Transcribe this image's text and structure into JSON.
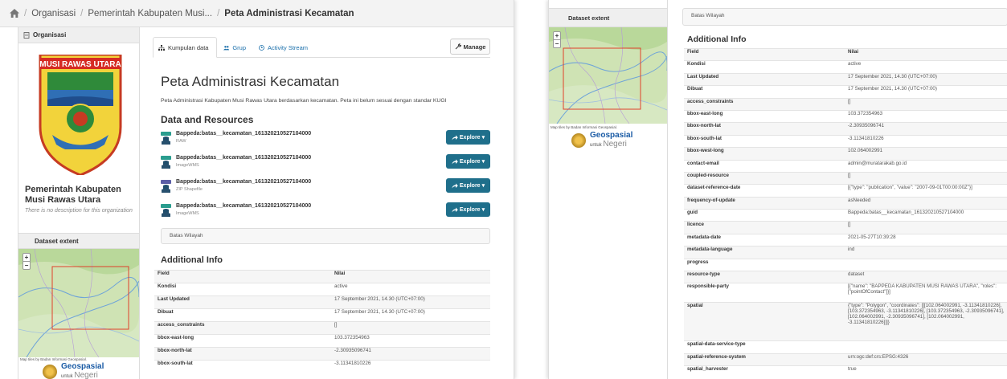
{
  "breadcrumb": {
    "items": [
      "Organisasi",
      "Pemerintah Kabupaten Musi..."
    ],
    "current": "Peta Administrasi Kecamatan"
  },
  "sidebar": {
    "org_heading": "Organisasi",
    "logo_text": "MUSI RAWAS UTARA",
    "org_name": "Pemerintah Kabupaten Musi Rawas Utara",
    "org_description": "There is no description for this organization",
    "extent_heading": "Dataset extent",
    "map_zoom_in": "+",
    "map_zoom_out": "−",
    "map_credit": "Map tiles by Badan Informasi Geospasial.",
    "geo_logo_name": "Geospasial",
    "geo_logo_for": "untuk",
    "geo_logo_country": "Negeri"
  },
  "tabs": [
    {
      "label": "Kumpulan data",
      "icon": "sitemap-icon",
      "active": true
    },
    {
      "label": "Grup",
      "icon": "users-icon",
      "active": false
    },
    {
      "label": "Activity Stream",
      "icon": "clock-icon",
      "active": false
    }
  ],
  "manage_label": "Manage",
  "dataset": {
    "title": "Peta Administrasi Kecamatan",
    "notes": "Peta Administrasi Kabupaten Musi Rawas Utara berdasarkan kecamatan. Peta ini belum sesuai dengan standar KUGI"
  },
  "resources_heading": "Data and Resources",
  "resources": [
    {
      "name": "Bappeda:batas__kecamatan_161320210527104000",
      "format": "RAW",
      "explore": "Explore"
    },
    {
      "name": "Bappeda:batas__kecamatan_161320210527104000",
      "format": "ImageWMS",
      "explore": "Explore"
    },
    {
      "name": "Bappeda:batas__kecamatan_161320210527104000",
      "format": "ZIP Shapefile",
      "explore": "Explore"
    },
    {
      "name": "Bappeda:batas__kecamatan_161320210527104000",
      "format": "ImageWMS",
      "explore": "Explore"
    }
  ],
  "tag": "Batas Wilayah",
  "additional_info_heading": "Additional Info",
  "info_headers": {
    "field": "Field",
    "value": "Nilai"
  },
  "info_rows": [
    {
      "field": "Kondisi",
      "value": "active"
    },
    {
      "field": "Last Updated",
      "value": "17 September 2021, 14.30 (UTC+07:00)"
    },
    {
      "field": "Dibuat",
      "value": "17 September 2021, 14.30 (UTC+07:00)"
    },
    {
      "field": "access_constraints",
      "value": "[]"
    },
    {
      "field": "bbox-east-long",
      "value": "103.372354963"
    },
    {
      "field": "bbox-north-lat",
      "value": "-2.30935096741"
    },
    {
      "field": "bbox-south-lat",
      "value": "-3.11341810226"
    },
    {
      "field": "bbox-west-long",
      "value": "102.064002991"
    },
    {
      "field": "contact-email",
      "value": "admin@muratarakab.go.id"
    },
    {
      "field": "coupled-resource",
      "value": "[]"
    },
    {
      "field": "dataset-reference-date",
      "value": "[{\"type\": \"publication\", \"value\": \"2007-09-01T00:00:00Z\"}]"
    },
    {
      "field": "frequency-of-update",
      "value": "asNeeded"
    },
    {
      "field": "guid",
      "value": "Bappeda:batas__kecamatan_161320210527104000"
    },
    {
      "field": "licence",
      "value": "[]"
    },
    {
      "field": "metadata-date",
      "value": "2021-05-27T10:39:28"
    },
    {
      "field": "metadata-language",
      "value": "ind"
    },
    {
      "field": "progress",
      "value": ""
    },
    {
      "field": "resource-type",
      "value": "dataset"
    },
    {
      "field": "responsible-party",
      "value": "[{\"name\": \"BAPPEDA KABUPATEN MUSI RAWAS UTARA\", \"roles\": [\"pointOfContact\"]}]"
    },
    {
      "field": "spatial",
      "value": "{\"type\": \"Polygon\", \"coordinates\": [[[102.064002991, -3.11341810226], [103.372354963, -3.11341810226], [103.372354963, -2.30935096741], [102.064002991, -2.30935096741], [102.064002991, -3.11341810226]]]}"
    },
    {
      "field": "spatial-data-service-type",
      "value": ""
    },
    {
      "field": "spatial-reference-system",
      "value": "urn:ogc:def:crs:EPSG:4326"
    },
    {
      "field": "spatial_harvester",
      "value": "true"
    }
  ],
  "colors": {
    "explore_button": "#1f6f8b",
    "link": "#1a6fab",
    "map_extent": "#e0402a",
    "logo_banner": "#d62b23"
  }
}
